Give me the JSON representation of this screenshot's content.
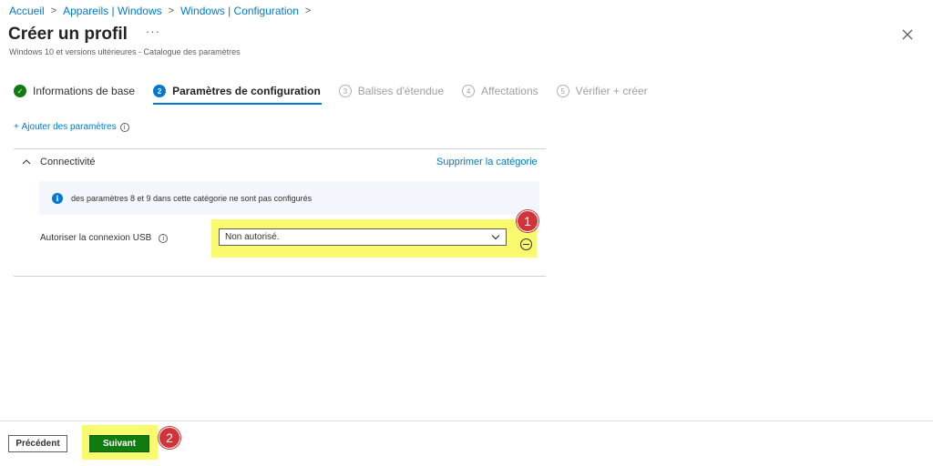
{
  "breadcrumb": {
    "items": [
      "Accueil",
      "Appareils | Windows",
      "Windows | Configuration"
    ],
    "separator": ">"
  },
  "header": {
    "title": "Créer un profil",
    "more": "···",
    "subtitle": "Windows 10 et versions ultérieures - Catalogue des paramètres"
  },
  "wizard": {
    "steps": [
      {
        "number": "✓",
        "label": "Informations de base",
        "state": "done"
      },
      {
        "number": "2",
        "label": "Paramètres de configuration",
        "state": "active"
      },
      {
        "number": "3",
        "label": "Balises d'étendue",
        "state": "todo"
      },
      {
        "number": "4",
        "label": "Affectations",
        "state": "todo"
      },
      {
        "number": "5",
        "label": "Vérifier + créer",
        "state": "todo"
      }
    ]
  },
  "add_settings": {
    "plus": "+",
    "label": "Ajouter des paramètres",
    "info": "i"
  },
  "category": {
    "name": "Connectivité",
    "delete_label": "Supprimer la catégorie",
    "info_icon": "i",
    "info_text": "des paramètres 8 et 9 dans cette catégorie ne sont pas configurés",
    "setting": {
      "label": "Autoriser la connexion USB",
      "info": "i",
      "value": "Non autorisé."
    }
  },
  "callouts": {
    "one": "1",
    "two": "2"
  },
  "footer": {
    "previous": "Précédent",
    "next": "Suivant"
  },
  "colors": {
    "accent": "#0078d4",
    "success": "#107c10",
    "highlight": "#fafa6e",
    "callout": "#d13438"
  },
  "icons": [
    "chevron-right-icon",
    "more-icon",
    "close-icon",
    "check-icon",
    "info-icon",
    "chevron-up-icon",
    "chevron-down-icon",
    "remove-icon"
  ]
}
